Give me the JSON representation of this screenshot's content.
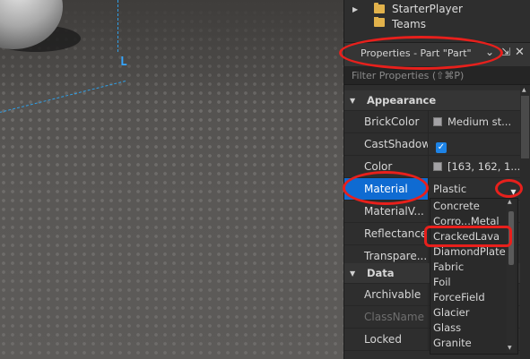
{
  "explorer": {
    "items": [
      {
        "label": "StarterPlayer"
      },
      {
        "label": "Teams"
      }
    ]
  },
  "properties": {
    "title": "Properties - Part \"Part\"",
    "filter_placeholder": "Filter Properties (⇧⌘P)",
    "sections": {
      "appearance": "Appearance",
      "data": "Data"
    },
    "rows": {
      "brickcolor": {
        "name": "BrickColor",
        "value": "Medium st..."
      },
      "castshadow": {
        "name": "CastShadow",
        "checked": true
      },
      "color": {
        "name": "Color",
        "value": "[163, 162, 1..."
      },
      "material": {
        "name": "Material",
        "value": "Plastic"
      },
      "materialvariant": {
        "name": "MaterialV..."
      },
      "reflectance": {
        "name": "Reflectance"
      },
      "transparency": {
        "name": "Transpare..."
      },
      "archivable": {
        "name": "Archivable"
      },
      "classname": {
        "name": "ClassName"
      },
      "locked": {
        "name": "Locked"
      }
    }
  },
  "material_dropdown": {
    "options": [
      "Concrete",
      "Corro...Metal",
      "CrackedLava",
      "DiamondPlate",
      "Fabric",
      "Foil",
      "ForceField",
      "Glacier",
      "Glass",
      "Granite"
    ]
  },
  "colors": {
    "selection": "#0f6bd2",
    "annotation": "#e8201c",
    "swatch_brickcolor": "#a3a2a5",
    "swatch_color": "#a3a2a5"
  }
}
